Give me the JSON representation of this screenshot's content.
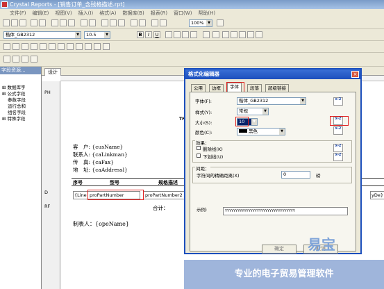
{
  "window": {
    "title": "Crystal Reports - [销售订单_含残格描述.rpt]"
  },
  "menu": [
    "文件(F)",
    "编辑(E)",
    "视图(V)",
    "插入(I)",
    "格式(A)",
    "数据库(B)",
    "报表(R)",
    "窗口(W)",
    "帮助(H)"
  ],
  "toolbar": {
    "zoom": "100%",
    "font": "楷体_GB2312",
    "size": "10.5",
    "bold": "B",
    "italic": "I",
    "underline": "U"
  },
  "field_explorer": {
    "title": "字段资源...",
    "items": [
      "数据库字",
      "公式字段",
      "参数字段",
      "运行总和",
      "组名字段",
      "特殊字段"
    ]
  },
  "design": {
    "tab": "设计",
    "sections": {
      "ph": "PH",
      "d": "D",
      "rf": "RF"
    },
    "header_fields": [
      {
        "label": "客　户:",
        "value": "{cusName}"
      },
      {
        "label": "联系人:",
        "value": "{caLinkman}"
      },
      {
        "label": "传　真:",
        "value": "{caFax}"
      },
      {
        "label": "地　址:",
        "value": "{caAddressl}"
      }
    ],
    "columns": [
      "序号",
      "型号",
      "规格描述"
    ],
    "detail_cells": [
      "{Line",
      "proPartNumber",
      "proPartNumber2",
      "yDe}"
    ],
    "footer_sum": "合计：",
    "footer_maker": "制表人：{opeName}",
    "title_frag": "TF"
  },
  "dialog": {
    "title": "格式化编辑器",
    "tabs": [
      "公用",
      "边框",
      "字体",
      "段落",
      "超级链接"
    ],
    "active_tab": "字体",
    "font_label": "字体(F):",
    "font_value": "楷体_GB2312",
    "style_label": "样式(Y):",
    "style_value": "常规",
    "size_label": "大小(S):",
    "size_value": "10",
    "color_label": "颜色(C):",
    "color_value": "黑色",
    "effects_label": "效果：",
    "strike_label": "删除线(K)",
    "underline_label": "下划线(U)",
    "spacing_label": "间距：",
    "spacing_desc": "字符间的精确距离(X)",
    "spacing_value": "0",
    "spacing_unit": "磅",
    "sample_label": "示例:",
    "sample_text": "YYYYYYYYYYYYYYYYYYYYYYYYYYYYYYYYY",
    "x2_label": "x-2",
    "ok": "确定",
    "cancel": "取消"
  },
  "watermark": {
    "brand": "易宝",
    "slogan": "专业的电子贸易管理软件"
  }
}
